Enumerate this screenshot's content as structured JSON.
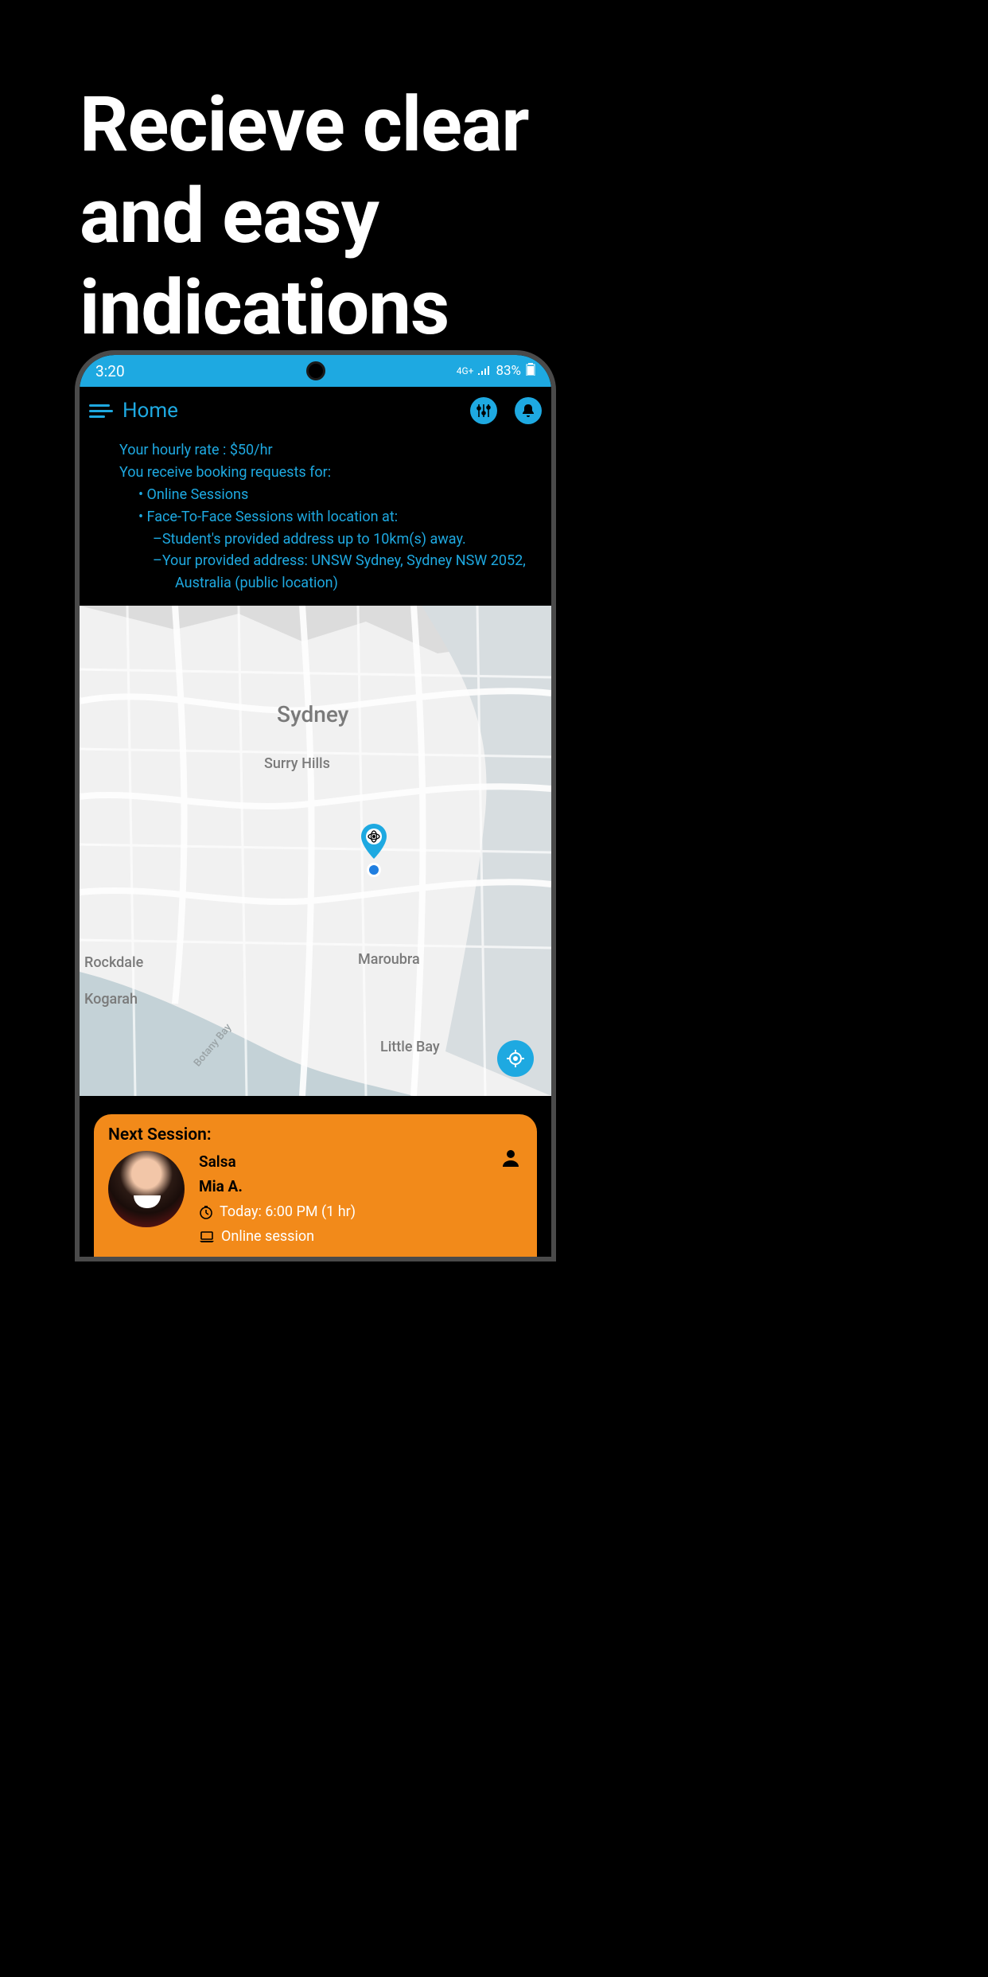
{
  "marketing": {
    "headline_line1": "Recieve clear",
    "headline_line2": "and easy",
    "headline_line3": "indications"
  },
  "status_bar": {
    "time": "3:20",
    "network": "4G+",
    "battery": "83%"
  },
  "app_bar": {
    "title": "Home"
  },
  "info": {
    "rate_line": "Your hourly rate : $50/hr",
    "requests_intro": "You receive booking requests for:",
    "bullet_online": "Online Sessions",
    "bullet_f2f": "Face-To-Face Sessions with location at:",
    "sub_student": "–Student's provided address up to 10km(s) away.",
    "sub_provided": "–Your provided address: UNSW Sydney, Sydney NSW 2052,",
    "sub_provided_wrap": "Australia (public location)"
  },
  "map": {
    "labels": {
      "sydney": "Sydney",
      "surry_hills": "Surry Hills",
      "maroubra": "Maroubra",
      "rockdale": "Rockdale",
      "kogarah": "Kogarah",
      "little_bay": "Little Bay",
      "botany_bay": "Botany Bay"
    }
  },
  "session": {
    "header": "Next Session:",
    "subject": "Salsa",
    "student_name": "Mia A.",
    "time_text": "Today: 6:00 PM (1 hr)",
    "mode_text": "Online session"
  },
  "colors": {
    "accent": "#1ea9e1",
    "card": "#f28a1a"
  }
}
